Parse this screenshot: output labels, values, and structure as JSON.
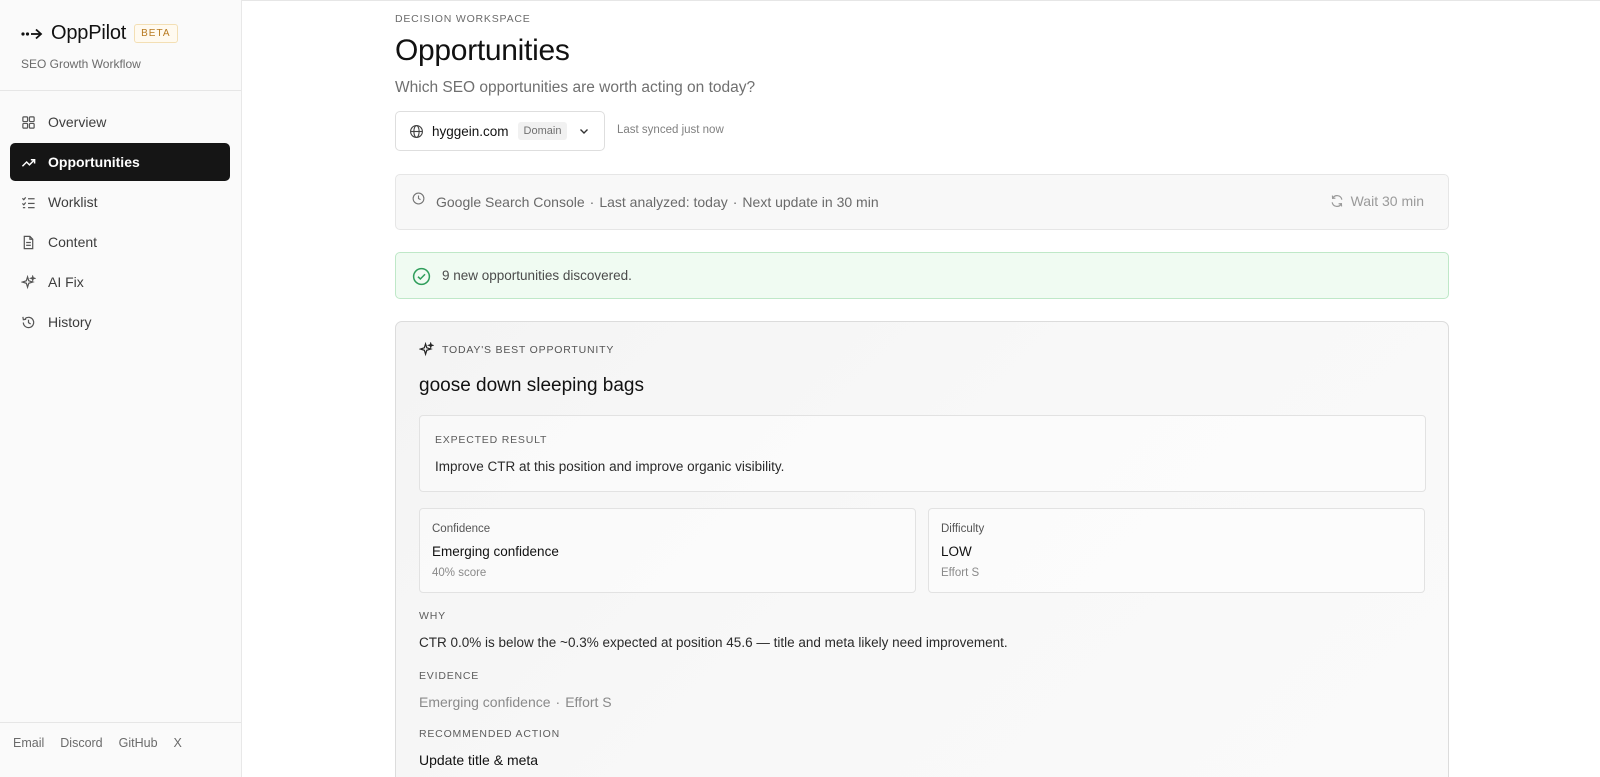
{
  "brand": {
    "name": "OppPilot",
    "badge": "BETA",
    "tagline": "SEO Growth Workflow"
  },
  "sidebar": {
    "items": [
      {
        "label": "Overview",
        "icon": "grid-icon",
        "active": false
      },
      {
        "label": "Opportunities",
        "icon": "trending-up-icon",
        "active": true
      },
      {
        "label": "Worklist",
        "icon": "checklist-icon",
        "active": false
      },
      {
        "label": "Content",
        "icon": "document-icon",
        "active": false
      },
      {
        "label": "AI Fix",
        "icon": "sparkles-icon",
        "active": false
      },
      {
        "label": "History",
        "icon": "history-icon",
        "active": false
      }
    ],
    "footer_links": [
      "Email",
      "Discord",
      "GitHub",
      "X"
    ]
  },
  "header": {
    "eyebrow": "DECISION WORKSPACE",
    "title": "Opportunities",
    "subtitle": "Which SEO opportunities are worth acting on today?"
  },
  "domain_selector": {
    "domain": "hyggein.com",
    "tag": "Domain",
    "synced": "Last synced just now"
  },
  "status": {
    "source": "Google Search Console",
    "last_analyzed": "Last analyzed: today",
    "next_update": "Next update in 30 min",
    "wait_label": "Wait 30 min"
  },
  "alert": {
    "text": "9 new opportunities discovered."
  },
  "best_opportunity": {
    "eyebrow": "TODAY'S BEST OPPORTUNITY",
    "keyword": "goose down sleeping bags",
    "expected_label": "EXPECTED RESULT",
    "expected_text": "Improve CTR at this position and improve organic visibility.",
    "confidence": {
      "label": "Confidence",
      "value": "Emerging confidence",
      "sub": "40% score"
    },
    "difficulty": {
      "label": "Difficulty",
      "value": "LOW",
      "sub": "Effort S"
    },
    "why_label": "WHY",
    "why_text": "CTR 0.0% is below the ~0.3% expected at position 45.6 — title and meta likely need improvement.",
    "evidence_label": "EVIDENCE",
    "evidence_items": [
      "Emerging confidence",
      "Effort S"
    ],
    "action_label": "RECOMMENDED ACTION",
    "action_text": "Update title & meta"
  },
  "colors": {
    "active_nav_bg": "#151515",
    "success_bg": "#f0fbf2",
    "success_border": "#bfe8c8",
    "success_icon": "#2f9e5b",
    "beta_text": "#b7791f"
  }
}
